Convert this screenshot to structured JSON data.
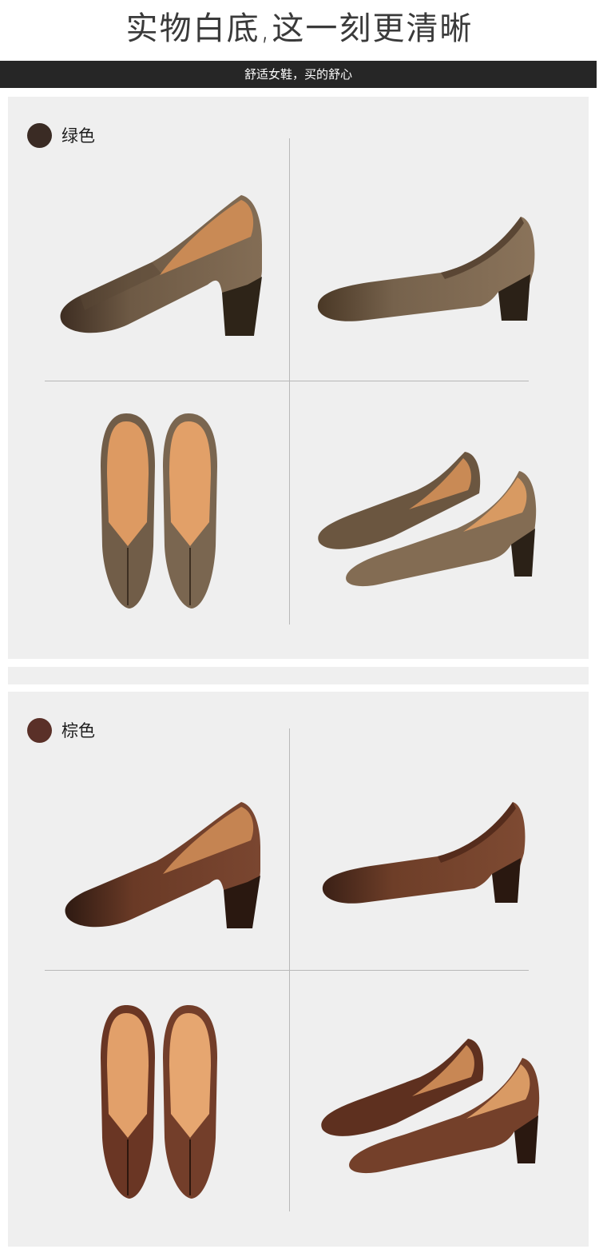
{
  "header": {
    "title": "实物白底,这一刻更清晰",
    "banner": "舒适女鞋，买的舒心"
  },
  "colors": {
    "banner_bg": "#262626",
    "panel_bg": "#efefef",
    "green_variant": "#7a634a",
    "brown_variant": "#6a3a26"
  },
  "variants": [
    {
      "label": "绿色",
      "swatch_color": "#3a2b24",
      "views": [
        "side-view-left",
        "side-view-right",
        "top-view-pair",
        "pair-angle-view"
      ]
    },
    {
      "label": "棕色",
      "swatch_color": "#5a3028",
      "views": [
        "side-view-left",
        "side-view-right",
        "top-view-pair",
        "pair-angle-view"
      ]
    }
  ]
}
